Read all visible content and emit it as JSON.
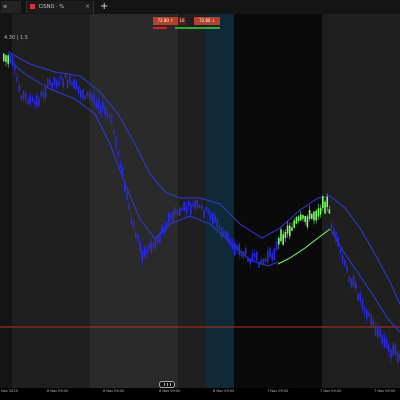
{
  "tabs": {
    "first_label": "≡",
    "second_label": "CISNO",
    "second_suffix": "· %",
    "close_glyph": "×",
    "add_glyph": "+"
  },
  "header": {
    "bid": "72.80 ↑",
    "spread": "16",
    "ask": "72.80 ↓"
  },
  "price_label": "4.30 | 1.5",
  "axis_ticks": [
    "Nov 2025",
    "8 Nov 09:00",
    "8 Nov 09:00",
    "8 Nov 09:00",
    "8 Nov 09:00",
    "7 Nov 09:00",
    "7 Nov 09:00",
    "7 Nov 09:00"
  ],
  "colors": {
    "background": "#000000",
    "band_dark": "#1f1f1f",
    "band_light": "#2a2a2a",
    "band_highlight": "#0f2a36",
    "candle_bear": "#2929e0",
    "candle_bull": "#7cff6a",
    "envelope_line": "#2d3ad8",
    "inner_line": "#3c3ce0",
    "horizontal_line": "#b3321c"
  }
}
